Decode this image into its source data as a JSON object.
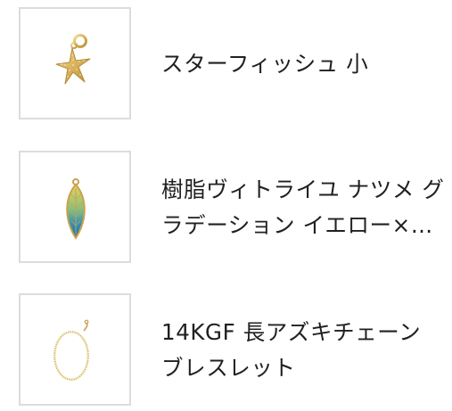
{
  "products": [
    {
      "title_lines": [
        "スターフィッシュ 小"
      ],
      "image_icon": "starfish-charm-icon"
    },
    {
      "title_lines": [
        "樹脂ヴィトライユ ナツメ グ",
        "ラデーション イエロー×ブ…"
      ],
      "image_icon": "resin-leaf-pendant-icon"
    },
    {
      "title_lines": [
        "14KGF 長アズキチェーン",
        "ブレスレット"
      ],
      "image_icon": "chain-bracelet-icon"
    }
  ],
  "colors": {
    "thumb_border": "#dcdcdc",
    "text": "#202020",
    "gold": "#d9b867"
  }
}
